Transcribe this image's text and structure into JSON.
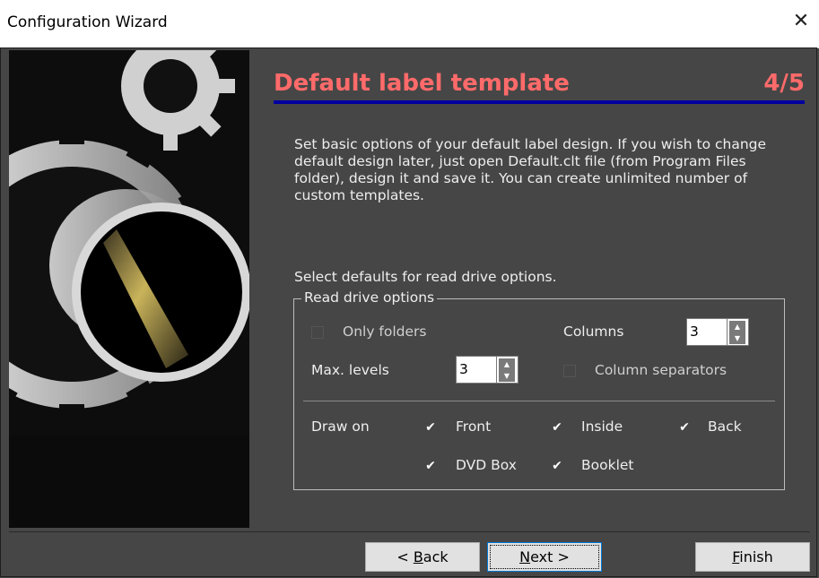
{
  "window": {
    "title": "Configuration Wizard"
  },
  "page": {
    "heading": "Default label template",
    "step": "4/5",
    "description": "Set basic options of your default label design. If you wish to change default design later, just open Default.clt file (from Program Files folder), design it and save it. You can create unlimited number of custom templates.",
    "select_label": "Select defaults for read drive options."
  },
  "read_drive_options": {
    "legend": "Read drive options",
    "only_folders": {
      "label": "Only folders",
      "checked": false
    },
    "columns": {
      "label": "Columns",
      "value": "3"
    },
    "max_levels": {
      "label": "Max. levels",
      "value": "3"
    },
    "column_separators": {
      "label": "Column separators",
      "checked": false
    },
    "draw_on": {
      "label": "Draw on",
      "front": {
        "label": "Front",
        "checked": true
      },
      "inside": {
        "label": "Inside",
        "checked": true
      },
      "back": {
        "label": "Back",
        "checked": true
      },
      "dvd_box": {
        "label": "DVD Box",
        "checked": true
      },
      "booklet": {
        "label": "Booklet",
        "checked": true
      }
    }
  },
  "buttons": {
    "back": {
      "prefix": "< ",
      "mnemonic": "B",
      "rest": "ack"
    },
    "next": {
      "mnemonic": "N",
      "rest": "ext >"
    },
    "finish": {
      "mnemonic": "F",
      "rest": "inish"
    }
  },
  "colors": {
    "heading": "#ff6a6a",
    "rule": "#0000a0",
    "background": "#464646"
  }
}
